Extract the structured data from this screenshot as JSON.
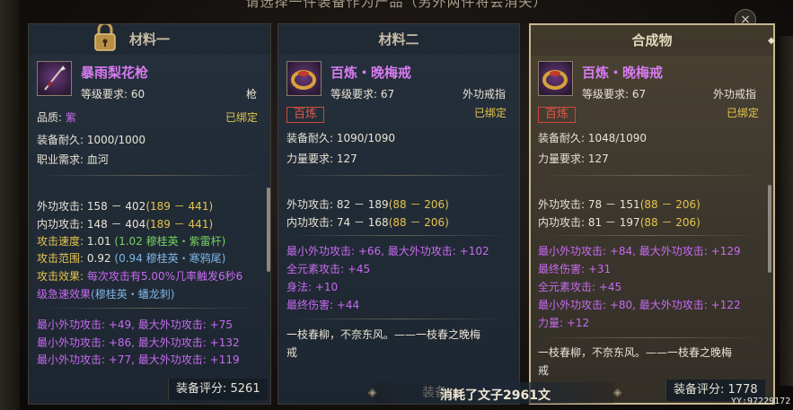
{
  "dialog": {
    "title": "请选择一件装备作为产品（另外两件将会消失）",
    "close_label": "×",
    "cost_text": "消耗了文子2961文",
    "ghost_button_label": "装备…",
    "watermark": "YY:97229172"
  },
  "panels": [
    {
      "header": "材料一",
      "locked": true,
      "item_name": "暴雨梨花枪",
      "item_icon": "spear-icon",
      "level_req": "等级要求:  60",
      "item_type": "枪",
      "quality_label": "品质:",
      "quality_value": "紫",
      "bound": "已绑定",
      "durability": "装备耐久:  1000/1000",
      "extra_req": "职业需求:  血河",
      "stats": [
        {
          "label": "外功攻击:",
          "value": "158 － 402",
          "bonus": "(189 － 441)"
        },
        {
          "label": "内功攻击:",
          "value": "148 － 404",
          "bonus": "(189 － 441)"
        },
        {
          "label": "攻击速度:",
          "value": "1.01",
          "bonus": "(1.02 穆桂英・紫雷杆)"
        },
        {
          "label": "攻击范围:",
          "value": "0.92",
          "bonus": "(0.94 穆桂英・寒鸦尾)"
        }
      ],
      "effect_label": "攻击效果:",
      "effect_line1": "每次攻击有5.00%几率触发6秒6",
      "effect_line2": "级急速效果",
      "effect_source": "(穆桂英・蟠龙刺)",
      "extra_stats": [
        "最小外功攻击:  +49,  最大外功攻击:  +75",
        "最小外功攻击:  +86,  最大外功攻击:  +132",
        "最小外功攻击:  +77,  最大外功攻击:  +119"
      ],
      "score": "装备评分:  5261"
    },
    {
      "header": "材料二",
      "item_name": "百炼・晚梅戒",
      "item_icon": "ring-icon",
      "level_req": "等级要求:  67",
      "item_type": "外功戒指",
      "badge": "百炼",
      "bound": "已绑定",
      "durability": "装备耐久:  1090/1090",
      "extra_req": "力量要求:  127",
      "stats": [
        {
          "label": "外功攻击:",
          "value": "82 － 189",
          "bonus": "(88 － 206)"
        },
        {
          "label": "内功攻击:",
          "value": "74 － 168",
          "bonus": "(88 － 206)"
        }
      ],
      "extra_stats": [
        "最小外功攻击:  +66,  最大外功攻击:  +102",
        "全元素攻击:  +45",
        "身法:  +10",
        "最终伤害:  +44"
      ],
      "flavor_line1": "一枝春柳，不奈东风。——一枝春之晚梅",
      "flavor_line2": "戒"
    },
    {
      "header": "合成物",
      "item_name": "百炼・晚梅戒",
      "item_icon": "ring-icon",
      "level_req": "等级要求:  67",
      "item_type": "外功戒指",
      "badge": "百炼",
      "bound": "已绑定",
      "durability": "装备耐久:  1048/1090",
      "extra_req": "力量要求:  127",
      "stats": [
        {
          "label": "外功攻击:",
          "value": "78 － 151",
          "bonus": "(88 － 206)"
        },
        {
          "label": "内功攻击:",
          "value": "81 － 197",
          "bonus": "(88 － 206)"
        }
      ],
      "extra_stats": [
        "最小外功攻击:  +84,  最大外功攻击:  +129",
        "最终伤害:  +31",
        "全元素攻击:  +45",
        "最小外功攻击:  +80,  最大外功攻击:  +122",
        "力量:  +12"
      ],
      "flavor_line1": "一枝春柳，不奈东风。——一枝春之晚梅",
      "flavor_line2": "戒",
      "score": "装备评分:  1778"
    }
  ],
  "colors": {
    "item_name": "#d77bf0",
    "bonus": "#e6c44e",
    "green_bonus": "#74d05f",
    "blue_bonus": "#7fb4e3",
    "purple_stat": "#c76bf0",
    "badge_red": "#e0584a",
    "selected_border": "#c9b78d"
  }
}
